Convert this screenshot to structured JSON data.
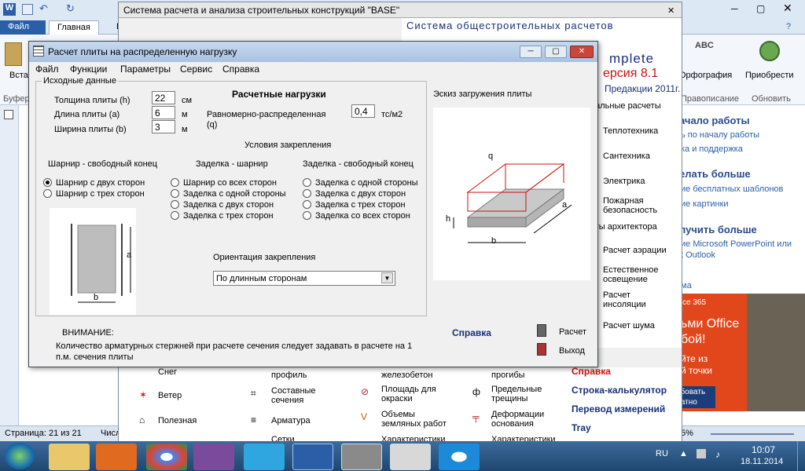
{
  "word": {
    "tab_file": "Файл",
    "tab_home": "Главная",
    "tab_partial": "Вс",
    "ribbon_left": "Вста",
    "buffer_label": "Буфер",
    "spelling_label": "Орфография",
    "spelling_group": "Правописание",
    "acquire_label": "Приобрести",
    "update_group": "Обновить",
    "status_page": "Страница: 21 из 21",
    "status_words": "Числ",
    "zoom": "5%",
    "abc": "ABC"
  },
  "word_pane": {
    "h_start": "ачало работы",
    "l1": "ь по началу работы",
    "l2": "ка и поддержка",
    "h_more": "елать больше",
    "l3": "ие бесплатных шаблонов",
    "l4": "ие картинки",
    "h_get": "лучить больше",
    "l5": "ие Microsoft PowerPoint или",
    "l6": "t Outlook",
    "l7": "ма",
    "ad_365": "ce 365",
    "ad_office": "ьми Office",
    "ad_boi": "бой!",
    "ad_iz": "йте из",
    "ad_tochki": "й точки",
    "ad_btn": "обовать",
    "ad_btn2": "латно"
  },
  "base": {
    "title": "Система расчета и анализа строительных конструкций \"BASE\"",
    "banner_top": "Система общестроительных расчетов",
    "banner_complete": "mplete",
    "banner_version": "ерсия 8.1",
    "banner_edition": "Предакции 2011г.",
    "right_header": "иальные расчеты",
    "right_items": [
      "Теплотехника",
      "Сантехника",
      "Электрика",
      "Пожарная безопасность"
    ],
    "right_header2": "еты архитектора",
    "right_items2": [
      "Расчет аэрации",
      "Естественное освещение",
      "Расчет инсоляции",
      "Расчет шума"
    ],
    "bottom_col1": [
      "Снег",
      "Ветер",
      "Полезная"
    ],
    "bottom_col2": [
      "профиль",
      "Составные сечения",
      "Арматура",
      "Сетки"
    ],
    "bottom_col3": [
      "железобетон",
      "Площадь для окраски",
      "Объемы земляных работ",
      "Характеристики"
    ],
    "bottom_col4": [
      "прогибы",
      "Предельные трещины",
      "Деформации основания",
      "Характеристики"
    ],
    "bottom_col5": [
      "Справка",
      "Строка-калькулятор",
      "Перевод измерений",
      "Tray"
    ]
  },
  "dialog": {
    "title": "Расчет плиты на распределенную нагрузку",
    "menu": [
      "Файл",
      "Функции",
      "Параметры",
      "Сервис",
      "Справка"
    ],
    "input_group": "Исходные данные",
    "thickness_label": "Толщина плиты (h)",
    "thickness_value": "22",
    "thickness_unit": "см",
    "length_label": "Длина плиты (a)",
    "length_value": "6",
    "length_unit": "м",
    "width_label": "Ширина плиты (b)",
    "width_value": "3",
    "width_unit": "м",
    "loads_title": "Расчетные нагрузки",
    "load_label": "Равномерно-распределенная (q)",
    "load_value": "0,4",
    "load_unit": "тс/м2",
    "fix_title": "Условия закрепления",
    "col1_title": "Шарнир - свободный конец",
    "col1": [
      "Шарнир с двух сторон",
      "Шарнир с трех сторон"
    ],
    "col2_title": "Заделка - шарнир",
    "col2": [
      "Шарнир со всех сторон",
      "Заделка с одной стороны",
      "Заделка с двух сторон",
      "Заделка с трех сторон"
    ],
    "col3_title": "Заделка - свободный конец",
    "col3": [
      "Заделка с одной стороны",
      "Заделка с двух сторон",
      "Заделка с трех сторон",
      "Заделка со всех сторон"
    ],
    "orient_label": "Ориентация закрепления",
    "orient_value": "По длинным сторонам",
    "sketch_title": "Эскиз загружения плиты",
    "warn_title": "ВНИМАНИЕ:",
    "warn_text": "Количество арматурных стержней при расчете сечения следует задавать в расчете на 1 п.м. сечения плиты",
    "help": "Справка",
    "calc": "Расчет",
    "exit": "Выход",
    "dim_a": "a",
    "dim_b": "b",
    "dim_h": "h",
    "dim_q": "q"
  },
  "taskbar": {
    "lang": "RU",
    "time": "10:07",
    "date": "18.11.2014"
  }
}
